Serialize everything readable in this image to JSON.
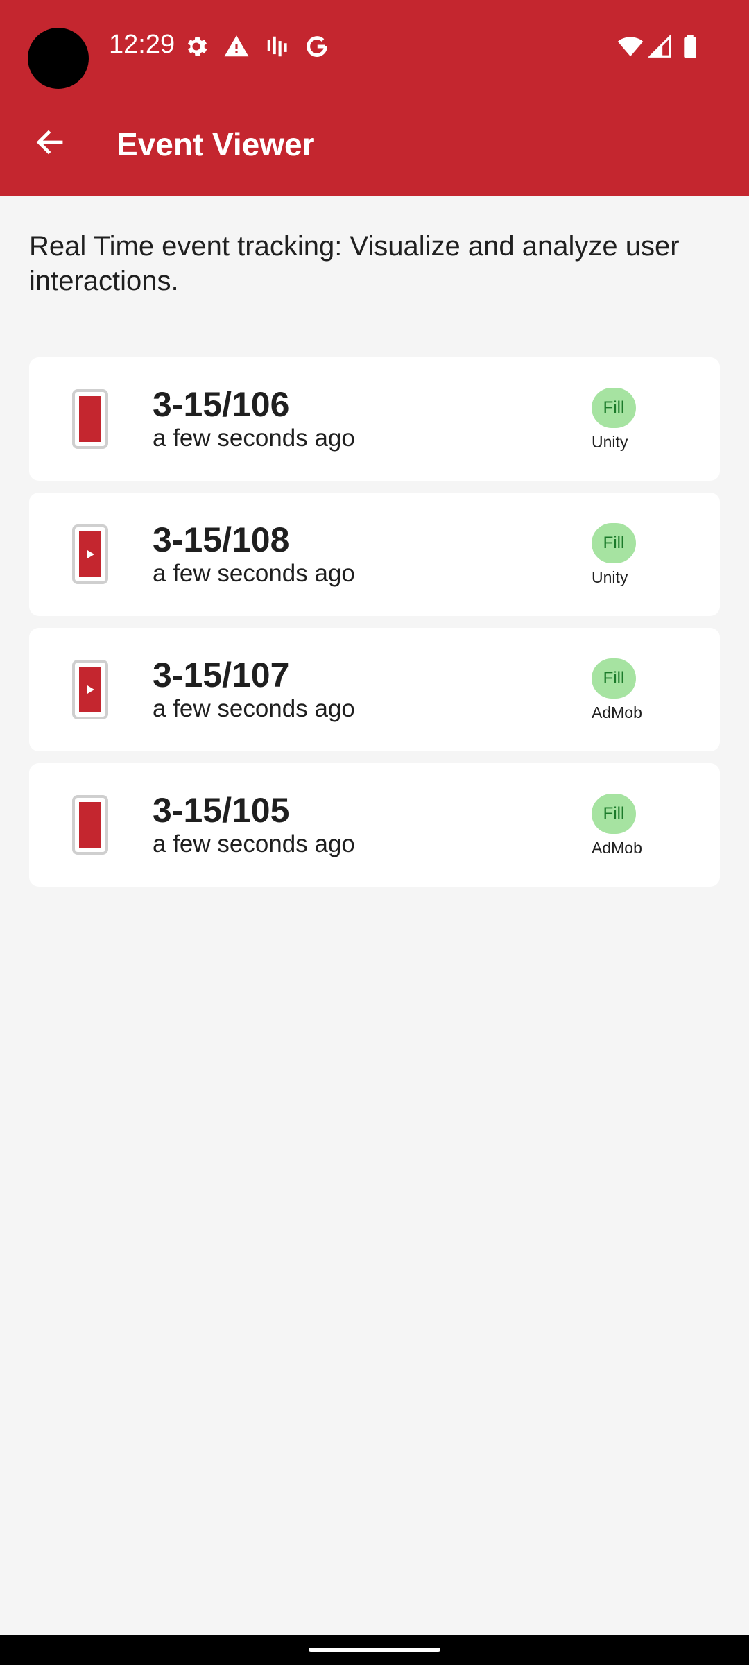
{
  "status_bar": {
    "time": "12:29",
    "left_icons": [
      "gear-icon",
      "warning-icon",
      "signal-bars-icon",
      "google-icon"
    ],
    "right_icons": [
      "wifi-icon",
      "cell-signal-icon",
      "battery-icon"
    ]
  },
  "toolbar": {
    "title": "Event Viewer",
    "back_icon": "arrow-left-icon"
  },
  "description": "Real Time event tracking: Visualize and analyze user interactions.",
  "colors": {
    "header": "#c4262f",
    "background": "#f5f5f5",
    "badge_bg": "#a6e3a1",
    "badge_text": "#1b7a2a"
  },
  "events": [
    {
      "id": "3-15/106",
      "time": "a few seconds ago",
      "status": "Fill",
      "network": "Unity",
      "icon": "device-banner-icon"
    },
    {
      "id": "3-15/108",
      "time": "a few seconds ago",
      "status": "Fill",
      "network": "Unity",
      "icon": "device-video-icon"
    },
    {
      "id": "3-15/107",
      "time": "a few seconds ago",
      "status": "Fill",
      "network": "AdMob",
      "icon": "device-video-icon"
    },
    {
      "id": "3-15/105",
      "time": "a few seconds ago",
      "status": "Fill",
      "network": "AdMob",
      "icon": "device-banner-icon"
    }
  ]
}
